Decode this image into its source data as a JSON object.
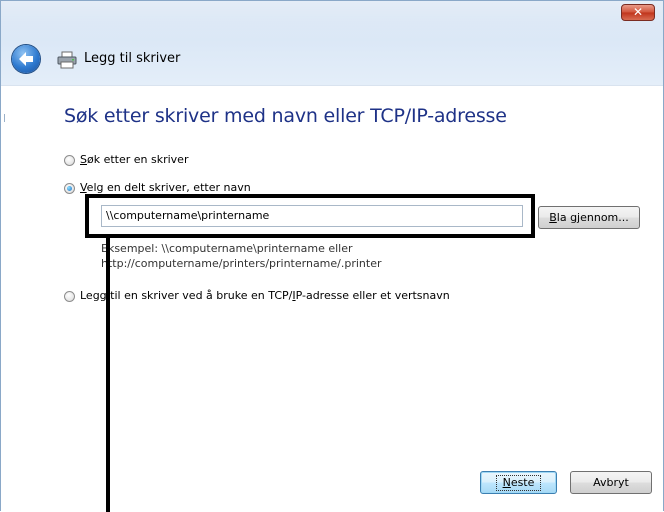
{
  "window": {
    "title": "Legg til skriver",
    "close_glyph": "✕",
    "close_color": "#c8391f",
    "accent_color": "#1e3287"
  },
  "wizard": {
    "heading": "Søk etter skriver med navn eller TCP/IP-adresse",
    "options": [
      {
        "label_accel": "S",
        "label_rest": "øk etter en skriver",
        "selected": false
      },
      {
        "label_accel": "V",
        "label_rest": "elg en delt skriver, etter navn",
        "selected": true
      },
      {
        "label_pre": "Legg til en skriver ved å bruke en TCP/",
        "label_accel": "I",
        "label_rest": "P-adresse eller et vertsnavn",
        "selected": false
      }
    ],
    "printer_path": {
      "value": "\\\\computername\\printername"
    },
    "browse_button": {
      "accel": "B",
      "rest": "la gjennom..."
    },
    "example_line1": "Eksempel: \\\\computername\\printername eller",
    "example_line2": "http://computername/printers/printername/.printer"
  },
  "footer": {
    "next_accel": "N",
    "next_rest": "este",
    "cancel_label": "Avbryt"
  },
  "icons": {
    "back": "back-arrow-icon",
    "printer": "printer-icon",
    "close": "close-icon"
  }
}
